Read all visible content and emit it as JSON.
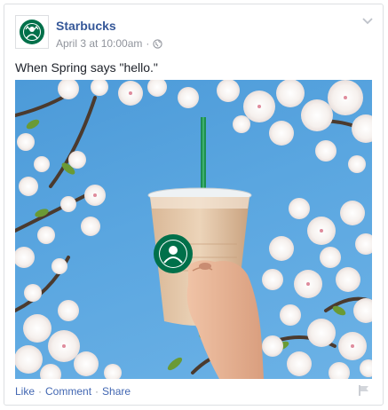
{
  "post": {
    "page_name": "Starbucks",
    "timestamp": "April 3 at 10:00am",
    "meta_separator": "·",
    "privacy_icon": "globe-icon",
    "caption": "When Spring says \"hello.\"",
    "photo_icon": "starbucks-cup-blossoms-photo"
  },
  "actions": {
    "like_label": "Like",
    "comment_label": "Comment",
    "share_label": "Share",
    "separator": "·",
    "report_icon": "flag-icon"
  },
  "colors": {
    "link": "#365899",
    "action_link": "#4267b2",
    "muted": "#90949c",
    "sky": "#5aa6e0",
    "brand_green": "#00704a"
  }
}
